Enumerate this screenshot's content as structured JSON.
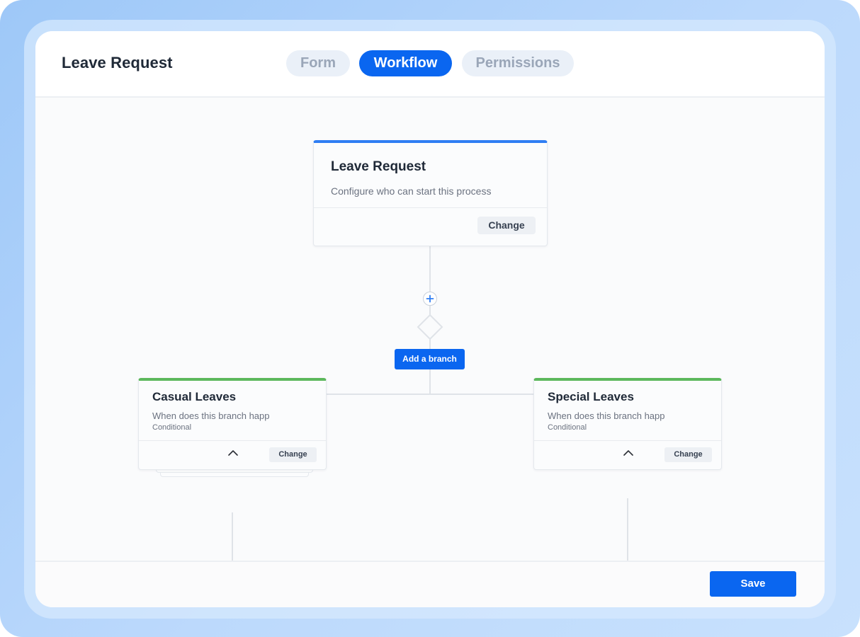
{
  "header": {
    "title": "Leave Request",
    "tabs": [
      {
        "label": "Form",
        "active": false
      },
      {
        "label": "Workflow",
        "active": true
      },
      {
        "label": "Permissions",
        "active": false
      }
    ]
  },
  "workflow": {
    "start_node": {
      "title": "Leave Request",
      "description": "Configure who can start this process",
      "action_label": "Change"
    },
    "add_step_icon": "plus-icon",
    "add_branch_label": "Add a branch",
    "branches": [
      {
        "title": "Casual Leaves",
        "description": "When does this branch happ",
        "condition": "Conditional",
        "action_label": "Change",
        "collapse_icon": "chevron-up-icon"
      },
      {
        "title": "Special Leaves",
        "description": "When does this branch happ",
        "condition": "Conditional",
        "action_label": "Change",
        "collapse_icon": "chevron-up-icon"
      }
    ]
  },
  "footer": {
    "save_label": "Save"
  },
  "colors": {
    "accent": "#0a66f0",
    "start_node_bar": "#2f7ef3",
    "branch_bar": "#5cb85c",
    "connector": "#dfe3e8"
  }
}
